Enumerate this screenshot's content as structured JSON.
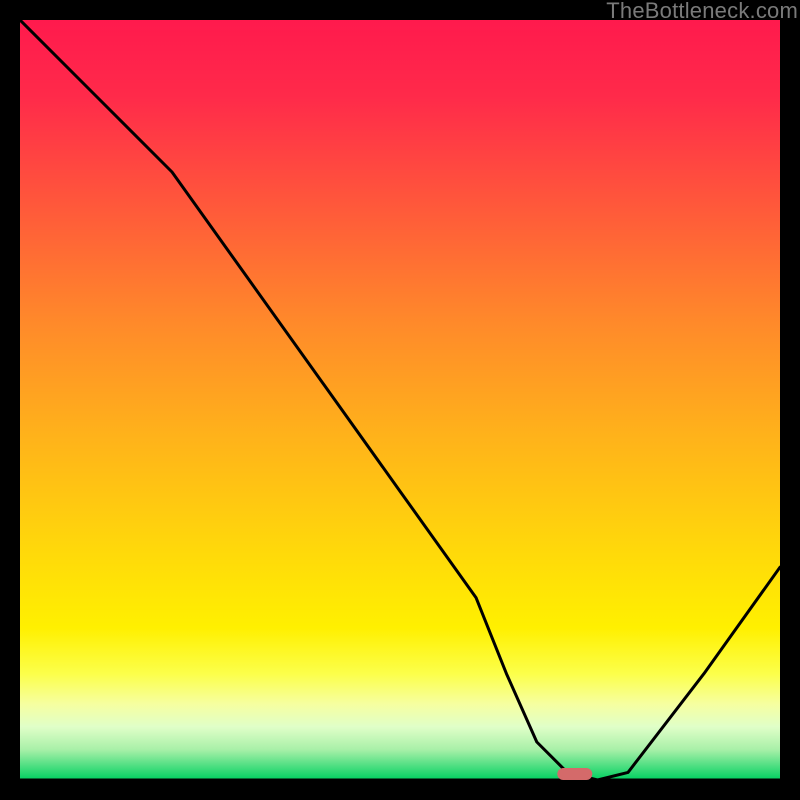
{
  "watermark": "TheBottleneck.com",
  "chart_data": {
    "type": "line",
    "title": "",
    "xlabel": "",
    "ylabel": "",
    "xlim": [
      0,
      100
    ],
    "ylim": [
      0,
      100
    ],
    "grid": false,
    "legend": false,
    "series": [
      {
        "name": "bottleneck-curve",
        "x": [
          0,
          10,
          20,
          30,
          40,
          50,
          60,
          64,
          68,
          72,
          76,
          80,
          90,
          100
        ],
        "values": [
          100,
          90,
          80,
          66,
          52,
          38,
          24,
          14,
          5,
          1,
          0,
          1,
          14,
          28
        ]
      }
    ],
    "minimum_marker": {
      "x_center": 73,
      "x_halfwidth": 2.3,
      "y": 0
    },
    "colors": {
      "curve": "#000000",
      "marker": "#d46a6a",
      "frame": "#000000",
      "gradient_top": "#ff1a4d",
      "gradient_bottom": "#00d060"
    }
  }
}
